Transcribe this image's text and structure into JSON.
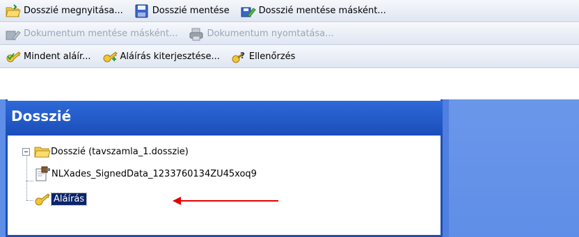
{
  "toolbar1": {
    "open_dossier": "Dosszié megnyitása...",
    "save_dossier": "Dosszié mentése",
    "save_dossier_as": "Dosszié mentése másként..."
  },
  "toolbar2": {
    "save_document_as": "Dokumentum mentése másként...",
    "print_document": "Dokumentum nyomtatása..."
  },
  "toolbar3": {
    "sign_all": "Mindent aláír...",
    "extend_signature": "Aláírás kiterjesztése...",
    "verify": "Ellenőrzés"
  },
  "panel": {
    "title": "Dosszié"
  },
  "tree": {
    "root_label": "Dosszié (tavszamla_1.dosszie)",
    "child_document": "NLXades_SignedData_1233760134ZU45xoq9",
    "child_signature": "Aláírás"
  },
  "colors": {
    "panel_header": "#1b4eb9",
    "annotation_arrow": "#e00000",
    "selection": "#0b246a"
  }
}
